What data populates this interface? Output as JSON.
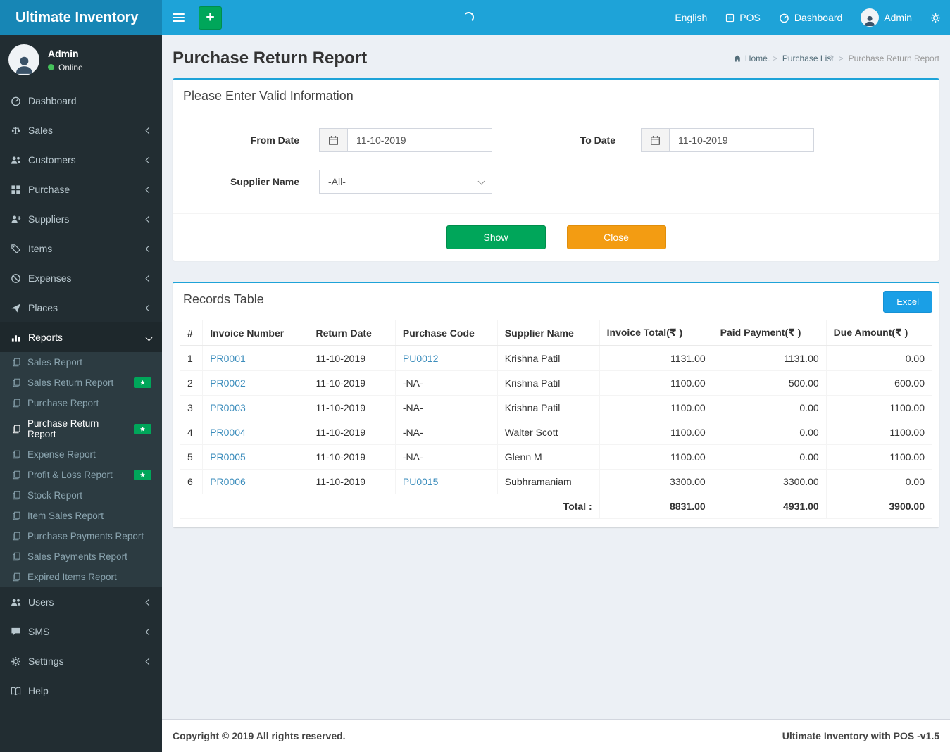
{
  "app": {
    "title": "Ultimate Inventory"
  },
  "colors": {
    "navbar": "#1ea3d8",
    "logo_background": "#1786b5",
    "sidebar_background": "#222d32",
    "submenu_background": "#2c3b41",
    "accent_green": "#00a65a",
    "accent_orange": "#f39c12",
    "excel_blue": "#1a9fe6",
    "link_blue": "#3c8dbc",
    "online_dot": "#45c25b",
    "content_background": "#ecf0f5"
  },
  "icons": {
    "toggle": "hamburger",
    "quick_add": "plus",
    "loading": "spinner",
    "pos": "plus-square",
    "dashboard": "gauge",
    "user": "person",
    "settings": "gears",
    "breadcrumb_home": "home",
    "date_addon": "calendar",
    "submenu_item": "file",
    "badge": "star"
  },
  "topbar": {
    "language": "English",
    "pos": "POS",
    "dashboard": "Dashboard",
    "user": "Admin"
  },
  "sidebar": {
    "user": {
      "name": "Admin",
      "status": "Online"
    },
    "menu": [
      {
        "label": "Dashboard",
        "icon": "gauge"
      },
      {
        "label": "Sales",
        "icon": "balance",
        "chevron": true
      },
      {
        "label": "Customers",
        "icon": "users",
        "chevron": true
      },
      {
        "label": "Purchase",
        "icon": "grid",
        "chevron": true
      },
      {
        "label": "Suppliers",
        "icon": "user-plus",
        "chevron": true
      },
      {
        "label": "Items",
        "icon": "tags",
        "chevron": true
      },
      {
        "label": "Expenses",
        "icon": "ban",
        "chevron": true
      },
      {
        "label": "Places",
        "icon": "paper-plane",
        "chevron": true
      },
      {
        "label": "Reports",
        "icon": "bar-chart",
        "expanded": true,
        "submenu": [
          {
            "label": "Sales Report"
          },
          {
            "label": "Sales Return Report",
            "badge": "star"
          },
          {
            "label": "Purchase Report"
          },
          {
            "label": "Purchase Return Report",
            "active": true,
            "badge": "star"
          },
          {
            "label": "Expense Report"
          },
          {
            "label": "Profit & Loss Report",
            "badge": "star"
          },
          {
            "label": "Stock Report"
          },
          {
            "label": "Item Sales Report"
          },
          {
            "label": "Purchase Payments Report"
          },
          {
            "label": "Sales Payments Report"
          },
          {
            "label": "Expired Items Report"
          }
        ]
      },
      {
        "label": "Users",
        "icon": "users",
        "chevron": true
      },
      {
        "label": "SMS",
        "icon": "comments",
        "chevron": true
      },
      {
        "label": "Settings",
        "icon": "gears",
        "chevron": true
      },
      {
        "label": "Help",
        "icon": "book"
      }
    ]
  },
  "page": {
    "title": "Purchase Return Report",
    "breadcrumb": [
      {
        "label": "Home"
      },
      {
        "label": "Purchase List"
      },
      {
        "label": "Purchase Return Report",
        "active": true
      }
    ]
  },
  "filter": {
    "title": "Please Enter Valid Information",
    "fields": {
      "from_date": {
        "label": "From Date",
        "value": "11-10-2019"
      },
      "to_date": {
        "label": "To Date",
        "value": "11-10-2019"
      },
      "supplier": {
        "label": "Supplier Name",
        "value": "-All-"
      }
    },
    "buttons": {
      "show": "Show",
      "close": "Close"
    }
  },
  "records": {
    "title": "Records Table",
    "excel_button": "Excel",
    "columns": [
      "#",
      "Invoice Number",
      "Return Date",
      "Purchase Code",
      "Supplier Name",
      "Invoice Total(₹ )",
      "Paid Payment(₹ )",
      "Due Amount(₹ )"
    ],
    "rows": [
      {
        "num": "1",
        "invoice": "PR0001",
        "return_date": "11-10-2019",
        "purchase_code": "PU0012",
        "code_is_link": true,
        "supplier": "Krishna Patil",
        "invoice_total": "1131.00",
        "paid_payment": "1131.00",
        "due_amount": "0.00"
      },
      {
        "num": "2",
        "invoice": "PR0002",
        "return_date": "11-10-2019",
        "purchase_code": "-NA-",
        "code_is_link": false,
        "supplier": "Krishna Patil",
        "invoice_total": "1100.00",
        "paid_payment": "500.00",
        "due_amount": "600.00"
      },
      {
        "num": "3",
        "invoice": "PR0003",
        "return_date": "11-10-2019",
        "purchase_code": "-NA-",
        "code_is_link": false,
        "supplier": "Krishna Patil",
        "invoice_total": "1100.00",
        "paid_payment": "0.00",
        "due_amount": "1100.00"
      },
      {
        "num": "4",
        "invoice": "PR0004",
        "return_date": "11-10-2019",
        "purchase_code": "-NA-",
        "code_is_link": false,
        "supplier": "Walter Scott",
        "invoice_total": "1100.00",
        "paid_payment": "0.00",
        "due_amount": "1100.00"
      },
      {
        "num": "5",
        "invoice": "PR0005",
        "return_date": "11-10-2019",
        "purchase_code": "-NA-",
        "code_is_link": false,
        "supplier": "Glenn M",
        "invoice_total": "1100.00",
        "paid_payment": "0.00",
        "due_amount": "1100.00"
      },
      {
        "num": "6",
        "invoice": "PR0006",
        "return_date": "11-10-2019",
        "purchase_code": "PU0015",
        "code_is_link": true,
        "supplier": "Subhramaniam",
        "invoice_total": "3300.00",
        "paid_payment": "3300.00",
        "due_amount": "0.00"
      }
    ],
    "total_label": "Total :",
    "totals": {
      "invoice_total": "8831.00",
      "paid_payment": "4931.00",
      "due_amount": "3900.00"
    }
  },
  "footer": {
    "left": "Copyright © 2019 All rights reserved.",
    "right": "Ultimate Inventory with POS -v1.5"
  }
}
